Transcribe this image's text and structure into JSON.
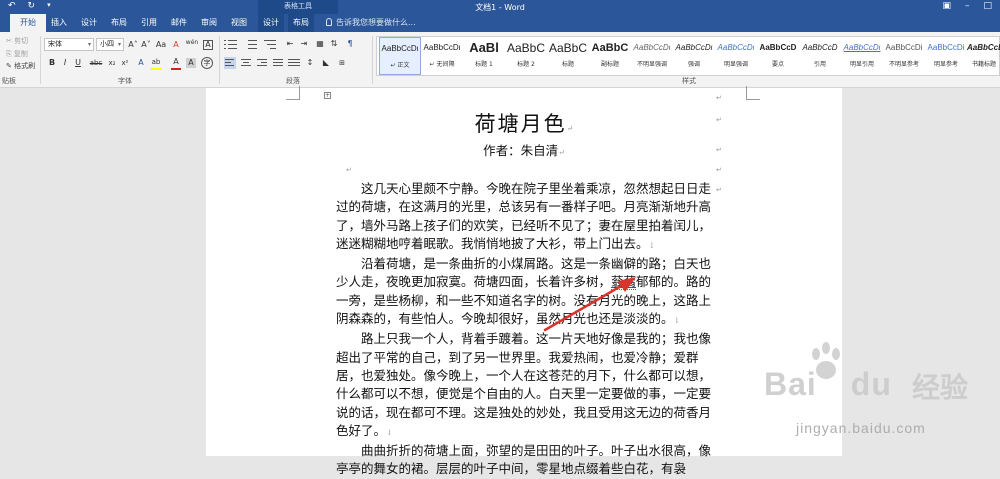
{
  "titlebar": {
    "undo_icon": "undo-icon",
    "redo_icon": "redo-icon",
    "qat_more_icon": "customize-qat-icon",
    "contextual_tools": "表格工具",
    "document_title": "文档1 - Word"
  },
  "tabs": [
    "开始",
    "插入",
    "设计",
    "布局",
    "引用",
    "邮件",
    "审阅",
    "视图",
    "设计",
    "布局"
  ],
  "active_tab": "开始",
  "tell_me": "告诉我您想要做什么...",
  "ribbon": {
    "clipboard": {
      "cut": "剪切",
      "copy": "复制",
      "format_painter": "格式刷",
      "label": "贴板"
    },
    "font": {
      "font_name": "宋体",
      "font_size": "小四",
      "label": "字体",
      "increase_size": "A˄",
      "decrease_size": "A˅",
      "case": "Aa",
      "clear_format": "A",
      "pinyin": "wén",
      "char_border": "A",
      "bold": "B",
      "italic": "I",
      "underline": "U",
      "strike": "abc",
      "subscript": "x₂",
      "superscript": "x²",
      "text_effect": "A",
      "highlight": "ab",
      "font_color": "A",
      "char_shade": "A",
      "enclose": "字"
    },
    "paragraph": {
      "label": "段落"
    },
    "styles": {
      "label": "样式",
      "items": [
        {
          "sample": "AaBbCcDι",
          "name": "↵ 正文",
          "selected": true
        },
        {
          "sample": "AaBbCcDι",
          "name": "↵ 无间隔",
          "selected": false
        },
        {
          "sample": "AaBl",
          "name": "标题 1",
          "selected": false
        },
        {
          "sample": "AaBbC",
          "name": "标题 2",
          "selected": false
        },
        {
          "sample": "AaBbC",
          "name": "标题",
          "selected": false
        },
        {
          "sample": "AaBbC",
          "name": "副标题",
          "selected": false
        },
        {
          "sample": "AaBbCcDι",
          "name": "不明显强调",
          "selected": false
        },
        {
          "sample": "AaBbCcDι",
          "name": "强调",
          "selected": false
        },
        {
          "sample": "AaBbCcDι",
          "name": "明显强调",
          "selected": false
        },
        {
          "sample": "AaBbCcD",
          "name": "要点",
          "selected": false
        },
        {
          "sample": "AaBbCcD",
          "name": "引用",
          "selected": false
        },
        {
          "sample": "AaBbCcDι",
          "name": "明显引用",
          "selected": false
        },
        {
          "sample": "AaBbCcDi",
          "name": "不明显参考",
          "selected": false
        },
        {
          "sample": "AaBbCcDi",
          "name": "明显参考",
          "selected": false
        },
        {
          "sample": "AaBbCcDd",
          "name": "书籍标题",
          "selected": false
        }
      ]
    }
  },
  "document": {
    "title": "荷塘月色",
    "author": "作者：朱自清",
    "paragraphs": [
      {
        "id": "p1",
        "lines": [
          "这几天心里颇不宁静。今晚在院子里坐着乘凉，忽然想起日日",
          "走过的荷塘，在这满月的光里，总该另有一番样子吧。月亮渐渐地",
          "升高了，墙外马路上孩子们的欢笑，已经听不见了；妻在屋里拍着",
          "闰儿，迷迷糊糊地哼着眠歌。我悄悄地披了大衫，带上门出去。"
        ]
      },
      {
        "id": "p2",
        "lines": [
          "沿着荷塘，是一条曲折的小煤屑路。这是一条幽僻的路；白天",
          "也少人走，夜晚更加寂寞。荷塘四面，长着许多树，",
          "郁郁的。",
          "路的一旁，是些杨柳，和一些不知道名字的树。没有月光的晚上，",
          "这路上阴森森的，有些怕人。今晚却很好，虽然月光也还是淡淡",
          "的。"
        ],
        "underlined": "蓊蓊"
      },
      {
        "id": "p3",
        "lines": [
          "路上只我一个人，背着手踱着。这一片天地好像是我的；我也",
          "像超出了平常的自己，到了另一世界里。我爱热闹，也爱冷静；爱",
          "群居，也爱独处。像今晚上，一个人在这苍茫的月下，什么都可以",
          "想，什么都可以不想，便觉是个自由的人。白天里一定要做的事，",
          "一定要说的话，现在都可不理。这是独处的妙处，我且受用这无边",
          "的荷香月色好了。"
        ]
      },
      {
        "id": "p4",
        "lines": [
          "曲曲折折的荷塘上面，弥望的是田田的叶子。叶子出水很高，",
          "像亭亭的舞女的裙。层层的叶子中间，零星地点缀着些白花，有袅"
        ]
      }
    ]
  },
  "watermark": {
    "brand": "Bai",
    "brand_end": "du",
    "product": "经验",
    "url": "jingyan.baidu.com"
  },
  "colors": {
    "brand_blue": "#2b579a",
    "annotation_red": "#d9342b",
    "page": "#ffffff",
    "canvas": "#e6e6e6"
  }
}
